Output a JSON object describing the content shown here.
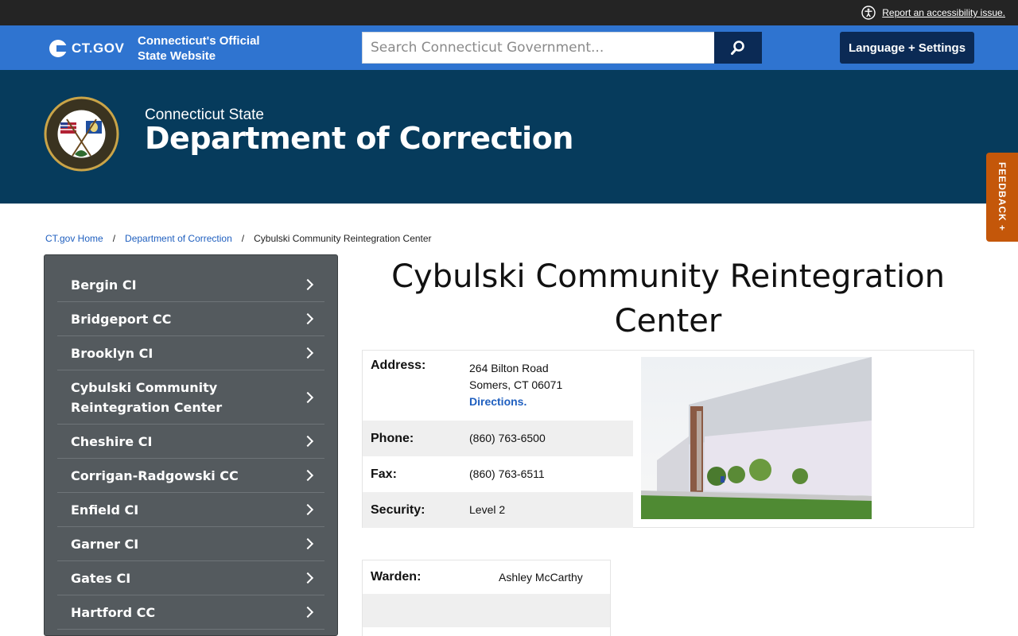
{
  "utility": {
    "accessibility_link": "Report an accessibility issue."
  },
  "statebar": {
    "logo_text": "CT.GOV",
    "official_line1": "Connecticut's Official",
    "official_line2": "State Website",
    "search_placeholder": "Search Connecticut Government...",
    "language_button": "Language + Settings"
  },
  "banner": {
    "subtitle": "Connecticut State",
    "title": "Department of Correction"
  },
  "feedback_label": "FEEDBACK +",
  "breadcrumb": {
    "home": "CT.gov Home",
    "separator": "/",
    "department": "Department of Correction",
    "current": "Cybulski Community Reintegration Center"
  },
  "sidebar": {
    "items": [
      {
        "label": "Bergin CI"
      },
      {
        "label": "Bridgeport CC"
      },
      {
        "label": "Brooklyn CI"
      },
      {
        "label": "Cybulski Community Reintegration Center"
      },
      {
        "label": "Cheshire CI"
      },
      {
        "label": "Corrigan-Radgowski CC"
      },
      {
        "label": "Enfield CI"
      },
      {
        "label": "Garner CI"
      },
      {
        "label": "Gates CI"
      },
      {
        "label": "Hartford CC"
      }
    ]
  },
  "main": {
    "title": "Cybulski Community Reintegration Center",
    "address_label": "Address:",
    "address_line1": "264 Bilton Road",
    "address_line2": "Somers, CT 06071",
    "directions_link": "Directions.",
    "phone_label": "Phone:",
    "phone": "(860) 763-6500",
    "fax_label": "Fax:",
    "fax": "(860) 763-6511",
    "security_label": "Security:",
    "security": "Level 2",
    "warden_label": "Warden:",
    "warden": "Ashley McCarthy"
  }
}
